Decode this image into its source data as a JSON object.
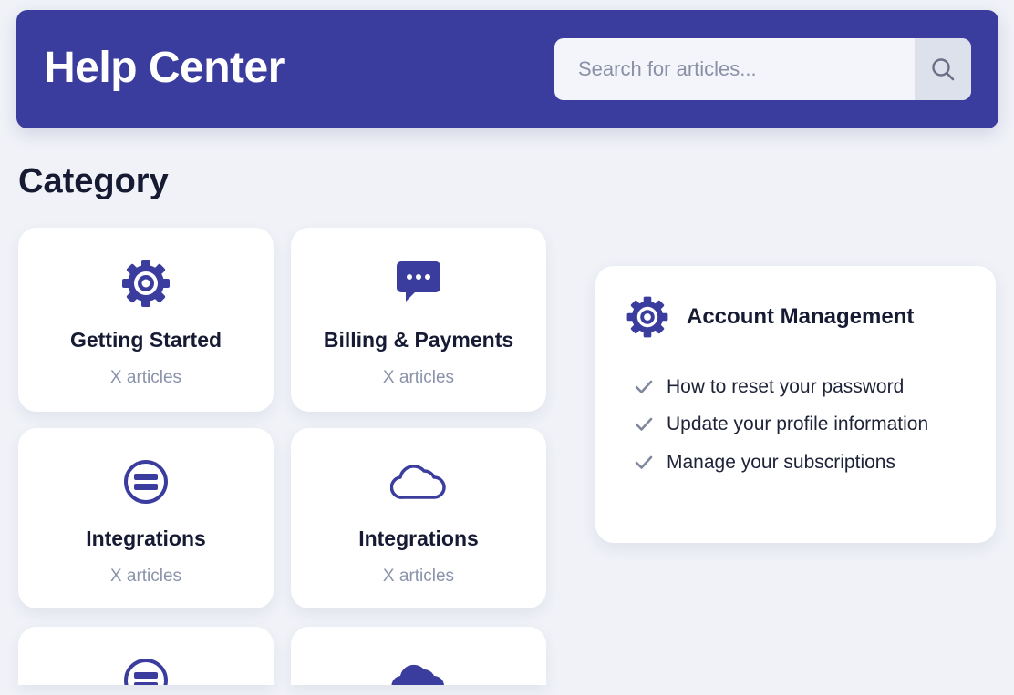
{
  "header": {
    "title": "Help Center",
    "background_color": "#3b3d9e",
    "search": {
      "placeholder": "Search for articles...",
      "icon": "search-icon"
    }
  },
  "category": {
    "heading": "Category",
    "cards": [
      {
        "title": "Getting Started",
        "count": "X articles",
        "icon": "gear-icon"
      },
      {
        "title": "Billing & Payments",
        "count": "X articles",
        "icon": "chat-bubble-icon"
      },
      {
        "title": "Integrations",
        "count": "X articles",
        "icon": "stack-icon"
      },
      {
        "title": "Integrations",
        "count": "X articles",
        "icon": "cloud-icon"
      },
      {
        "title": "",
        "count": "",
        "icon": "stack-icon"
      },
      {
        "title": "",
        "count": "",
        "icon": "cloud-icon"
      }
    ]
  },
  "panel": {
    "title": "Account Management",
    "icon": "gear-icon",
    "items": [
      "How to reset your password",
      "Update your profile information",
      "Manage your subscriptions"
    ]
  },
  "colors": {
    "accent": "#3b3d9e",
    "page_bg": "#f0f2f8",
    "muted_text": "#8a93ab"
  }
}
